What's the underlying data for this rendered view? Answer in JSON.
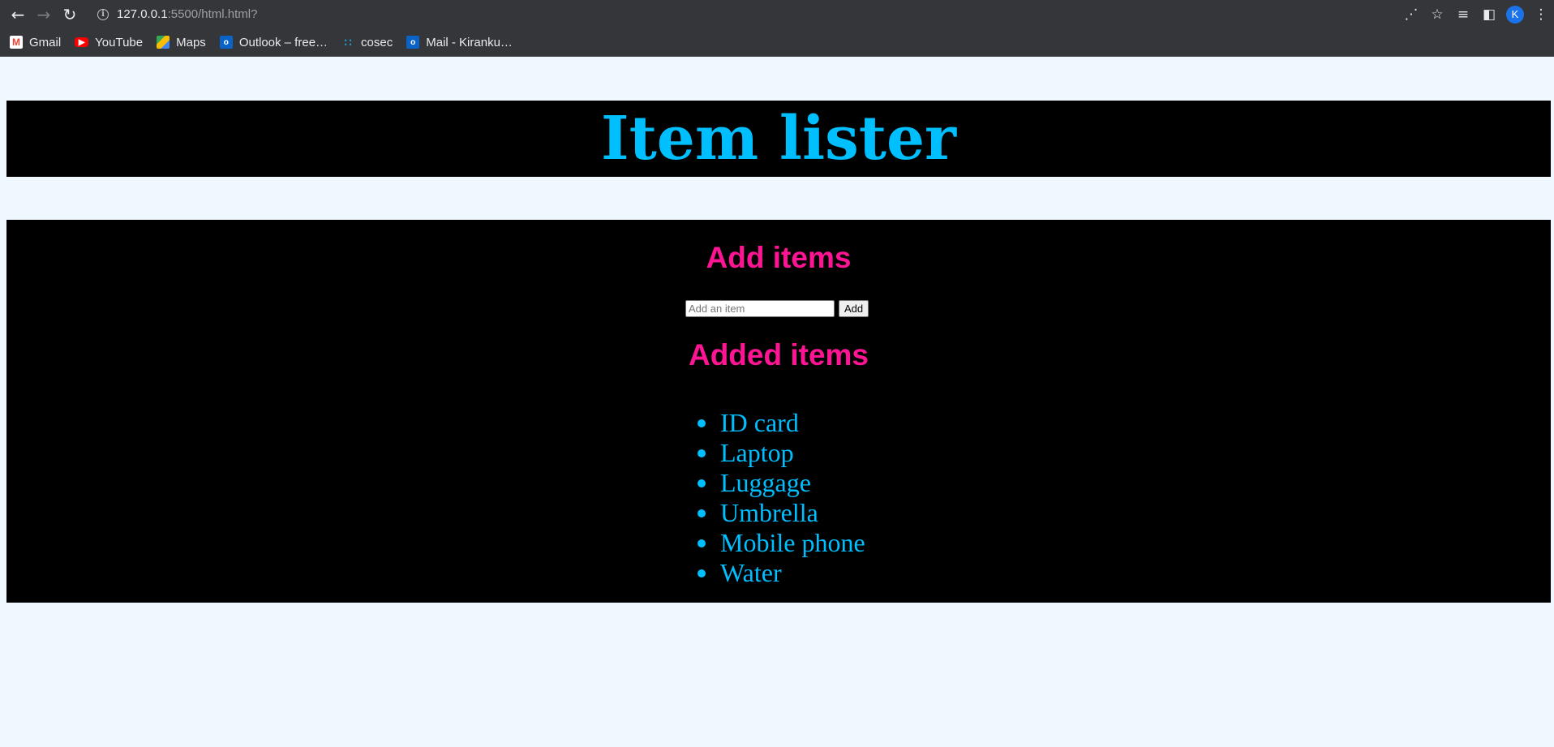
{
  "browser": {
    "url_host": "127.0.0.1",
    "url_rest": ":5500/html.html?",
    "profile_initial": "K",
    "bookmarks": [
      {
        "label": "Gmail",
        "icon": "gmail-icon"
      },
      {
        "label": "YouTube",
        "icon": "youtube-icon"
      },
      {
        "label": "Maps",
        "icon": "maps-icon"
      },
      {
        "label": "Outlook – free…",
        "icon": "outlook-icon"
      },
      {
        "label": "cosec",
        "icon": "cosec-icon"
      },
      {
        "label": "Mail - Kiranku…",
        "icon": "outlook-icon"
      }
    ]
  },
  "page": {
    "title": "Item lister",
    "add_heading": "Add items",
    "input_placeholder": "Add an item",
    "add_button": "Add",
    "list_heading": "Added items",
    "items": [
      "ID card",
      "Laptop",
      "Luggage",
      "Umbrella",
      "Mobile phone",
      "Water"
    ]
  },
  "colors": {
    "title": "#00bfff",
    "heading": "#ff1493",
    "panel": "#000000",
    "page_bg": "#f0f8ff"
  }
}
